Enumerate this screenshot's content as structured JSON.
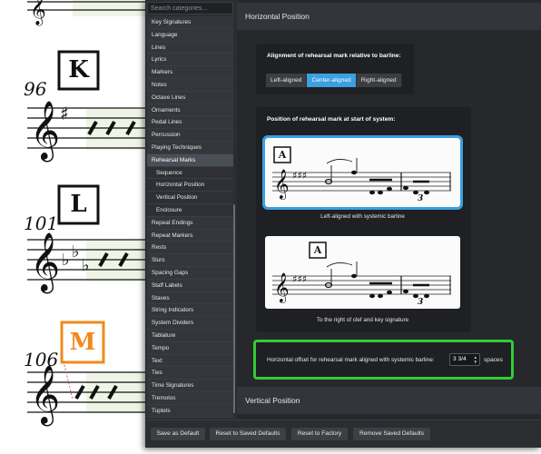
{
  "score": {
    "rehearsal_marks": [
      "K",
      "L",
      "M"
    ],
    "bar_numbers": [
      "96",
      "101",
      "106"
    ],
    "highlight_color": "#f08a1c"
  },
  "sidebar": {
    "search_placeholder": "Search categories...",
    "items": [
      {
        "label": "Key Signatures",
        "sub": false,
        "active": false
      },
      {
        "label": "Language",
        "sub": false,
        "active": false
      },
      {
        "label": "Lines",
        "sub": false,
        "active": false
      },
      {
        "label": "Lyrics",
        "sub": false,
        "active": false
      },
      {
        "label": "Markers",
        "sub": false,
        "active": false
      },
      {
        "label": "Notes",
        "sub": false,
        "active": false
      },
      {
        "label": "Octave Lines",
        "sub": false,
        "active": false
      },
      {
        "label": "Ornaments",
        "sub": false,
        "active": false
      },
      {
        "label": "Pedal Lines",
        "sub": false,
        "active": false
      },
      {
        "label": "Percussion",
        "sub": false,
        "active": false
      },
      {
        "label": "Playing Techniques",
        "sub": false,
        "active": false
      },
      {
        "label": "Rehearsal Marks",
        "sub": false,
        "active": true
      },
      {
        "label": "Sequence",
        "sub": true,
        "active": false
      },
      {
        "label": "Horizontal Position",
        "sub": true,
        "active": false
      },
      {
        "label": "Vertical Position",
        "sub": true,
        "active": false
      },
      {
        "label": "Enclosure",
        "sub": true,
        "active": false
      },
      {
        "label": "Repeat Endings",
        "sub": false,
        "active": false
      },
      {
        "label": "Repeat Markers",
        "sub": false,
        "active": false
      },
      {
        "label": "Rests",
        "sub": false,
        "active": false
      },
      {
        "label": "Slurs",
        "sub": false,
        "active": false
      },
      {
        "label": "Spacing Gaps",
        "sub": false,
        "active": false
      },
      {
        "label": "Staff Labels",
        "sub": false,
        "active": false
      },
      {
        "label": "Staves",
        "sub": false,
        "active": false
      },
      {
        "label": "String Indicators",
        "sub": false,
        "active": false
      },
      {
        "label": "System Dividers",
        "sub": false,
        "active": false
      },
      {
        "label": "Tablature",
        "sub": false,
        "active": false
      },
      {
        "label": "Tempo",
        "sub": false,
        "active": false
      },
      {
        "label": "Text",
        "sub": false,
        "active": false
      },
      {
        "label": "Ties",
        "sub": false,
        "active": false
      },
      {
        "label": "Time Signatures",
        "sub": false,
        "active": false
      },
      {
        "label": "Tremolos",
        "sub": false,
        "active": false
      },
      {
        "label": "Tuplets",
        "sub": false,
        "active": false
      }
    ]
  },
  "main": {
    "section_title": "Horizontal Position",
    "alignment": {
      "title": "Alignment of rehearsal mark relative to barline:",
      "options": [
        "Left-aligned",
        "Center-aligned",
        "Right-aligned"
      ],
      "selected": "Center-aligned"
    },
    "position": {
      "title": "Position of rehearsal mark at start of system:",
      "option1_mark": "A",
      "option1_caption": "Left-aligned with systemic barline",
      "option2_mark": "A",
      "option2_caption": "To the right of clef and key signature",
      "tuplet_number": "3",
      "selected": "Left-aligned with systemic barline"
    },
    "offset": {
      "label": "Horizontal offset for rehearsal mark aligned with systemic barline:",
      "value": "3 3/4",
      "units": "spaces",
      "highlight_color": "#33cc33"
    },
    "next_section_title": "Vertical Position"
  },
  "footer": {
    "save_default": "Save as Default",
    "reset_saved": "Reset to Saved Defaults",
    "reset_factory": "Reset to Factory",
    "remove_saved": "Remove Saved Defaults"
  },
  "colors": {
    "accent": "#3aa0e0",
    "dialog_bg": "#2b2d31"
  }
}
